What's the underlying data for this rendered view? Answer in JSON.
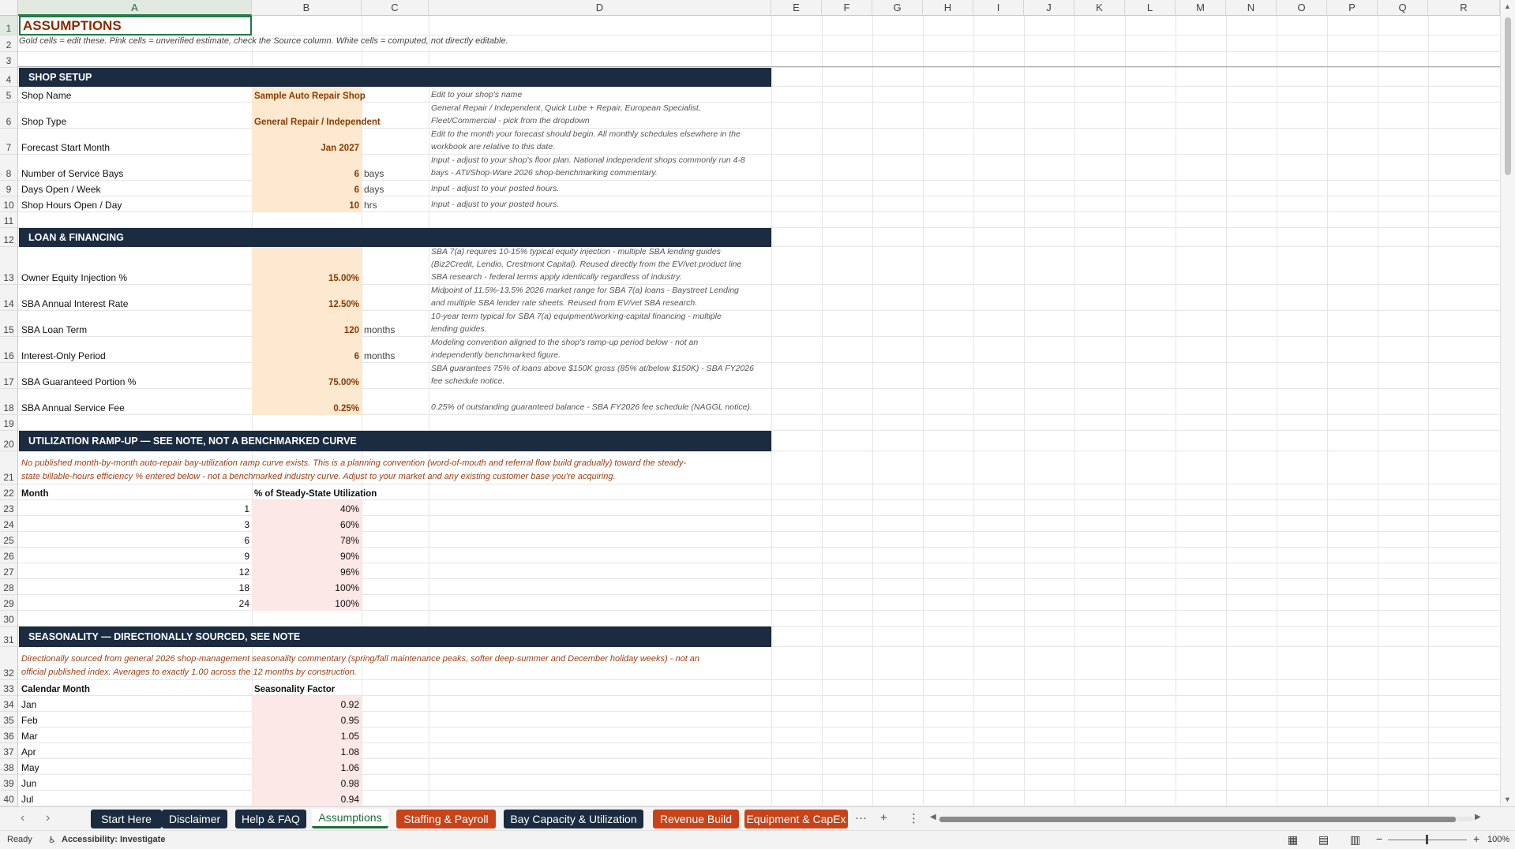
{
  "columns": [
    "A",
    "B",
    "C",
    "D",
    "E",
    "F",
    "G",
    "H",
    "I",
    "J",
    "K",
    "L",
    "M",
    "N",
    "O",
    "P",
    "Q",
    "R"
  ],
  "rows": [
    "1",
    "2",
    "3",
    "4",
    "5",
    "6",
    "7",
    "8",
    "9",
    "10",
    "11",
    "12",
    "13",
    "14",
    "15",
    "16",
    "17",
    "18",
    "19",
    "20",
    "21",
    "22",
    "23",
    "24",
    "25",
    "26",
    "27",
    "28",
    "29",
    "30",
    "31",
    "32",
    "33",
    "34",
    "35",
    "36",
    "37",
    "38",
    "39",
    "40"
  ],
  "title": "ASSUMPTIONS",
  "subtitle": "Gold cells = edit these. Pink cells = unverified estimate, check the Source column. White cells = computed, not directly editable.",
  "shop_setup": {
    "banner": "SHOP SETUP",
    "rows": [
      {
        "label": "Shop Name",
        "value": "Sample Auto Repair Shop",
        "unit": "",
        "note": [
          "Edit to your shop's name"
        ]
      },
      {
        "label": "Shop Type",
        "value": "General Repair / Independent",
        "unit": "",
        "note": [
          "General Repair / Independent, Quick Lube + Repair, European Specialist,",
          "Fleet/Commercial - pick from the dropdown"
        ]
      },
      {
        "label": "Forecast Start Month",
        "value": "Jan 2027",
        "unit": "",
        "note": [
          "Edit to the month your forecast should begin. All monthly schedules elsewhere in the",
          "workbook are relative to this date."
        ]
      },
      {
        "label": "Number of Service Bays",
        "value": "6",
        "unit": "bays",
        "note": [
          "Input - adjust to your shop's floor plan. National independent shops commonly run 4-8",
          "bays - ATI/Shop-Ware 2026 shop-benchmarking commentary."
        ]
      },
      {
        "label": "Days Open / Week",
        "value": "6",
        "unit": "days",
        "note": [
          "Input - adjust to your posted hours."
        ]
      },
      {
        "label": "Shop Hours Open / Day",
        "value": "10",
        "unit": "hrs",
        "note": [
          "Input - adjust to your posted hours."
        ]
      }
    ]
  },
  "loan": {
    "banner": "LOAN & FINANCING",
    "rows": [
      {
        "label": "Owner Equity Injection %",
        "value": "15.00%",
        "unit": "",
        "note": [
          "SBA 7(a) requires 10-15% typical equity injection - multiple SBA lending guides",
          "(Biz2Credit, Lendio, Crestmont Capital). Reused directly from the EV/vet product line",
          "SBA research - federal terms apply identically regardless of industry."
        ]
      },
      {
        "label": "SBA Annual Interest Rate",
        "value": "12.50%",
        "unit": "",
        "note": [
          "Midpoint of 11.5%-13.5% 2026 market range for SBA 7(a) loans - Baystreet Lending",
          "and multiple SBA lender rate sheets. Reused from EV/vet SBA research."
        ]
      },
      {
        "label": "SBA Loan Term",
        "value": "120",
        "unit": "months",
        "note": [
          "10-year term typical for SBA 7(a) equipment/working-capital financing - multiple",
          "lending guides."
        ]
      },
      {
        "label": "Interest-Only Period",
        "value": "6",
        "unit": "months",
        "note": [
          "Modeling convention aligned to the shop's ramp-up period below - not an",
          "independently benchmarked figure."
        ]
      },
      {
        "label": "SBA Guaranteed Portion %",
        "value": "75.00%",
        "unit": "",
        "note": [
          "SBA guarantees 75% of loans above $150K gross (85% at/below $150K) - SBA FY2026",
          "fee schedule notice."
        ]
      },
      {
        "label": "SBA Annual Service Fee",
        "value": "0.25%",
        "unit": "",
        "note": [
          "0.25% of outstanding guaranteed balance - SBA FY2026 fee schedule (NAGGL notice)."
        ]
      }
    ]
  },
  "ramp": {
    "banner": "UTILIZATION RAMP-UP  —  SEE NOTE, NOT A BENCHMARKED CURVE",
    "note": [
      "No published month-by-month auto-repair bay-utilization ramp curve exists. This is a planning convention (word-of-mouth and referral flow build gradually) toward the steady-",
      "state billable-hours efficiency % entered below - not a benchmarked industry curve. Adjust to your market and any existing customer base you're acquiring."
    ],
    "col_month": "Month",
    "col_pct": "% of Steady-State Utilization",
    "data": [
      {
        "month": "1",
        "pct": "40%"
      },
      {
        "month": "3",
        "pct": "60%"
      },
      {
        "month": "6",
        "pct": "78%"
      },
      {
        "month": "9",
        "pct": "90%"
      },
      {
        "month": "12",
        "pct": "96%"
      },
      {
        "month": "18",
        "pct": "100%"
      },
      {
        "month": "24",
        "pct": "100%"
      }
    ]
  },
  "season": {
    "banner": "SEASONALITY  —  DIRECTIONALLY SOURCED, SEE NOTE",
    "note": [
      "Directionally sourced from general 2026 shop-management seasonality commentary (spring/fall maintenance peaks, softer deep-summer and December holiday weeks) - not an",
      "official published index. Averages to exactly 1.00 across the 12 months by construction."
    ],
    "col_month": "Calendar Month",
    "col_factor": "Seasonality Factor",
    "data": [
      {
        "month": "Jan",
        "factor": "0.92"
      },
      {
        "month": "Feb",
        "factor": "0.95"
      },
      {
        "month": "Mar",
        "factor": "1.05"
      },
      {
        "month": "Apr",
        "factor": "1.08"
      },
      {
        "month": "May",
        "factor": "1.06"
      },
      {
        "month": "Jun",
        "factor": "0.98"
      },
      {
        "month": "Jul",
        "factor": "0.94"
      }
    ]
  },
  "tabs": [
    {
      "label": "Start Here",
      "style": "dark"
    },
    {
      "label": "Disclaimer",
      "style": "dark"
    },
    {
      "label": "Help & FAQ",
      "style": "dark"
    },
    {
      "label": "Assumptions",
      "style": "active"
    },
    {
      "label": "Staffing & Payroll",
      "style": "orange"
    },
    {
      "label": "Bay Capacity & Utilization",
      "style": "dark"
    },
    {
      "label": "Revenue Build",
      "style": "orange"
    },
    {
      "label": "Equipment & CapEx",
      "style": "orange"
    }
  ],
  "tabbar_icons": {
    "prev": "‹",
    "next": "›",
    "more": "···",
    "add": "+",
    "options": "⋮"
  },
  "status": {
    "ready": "Ready",
    "accessibility": "Accessibility: Investigate",
    "zoom": "100%",
    "zoom_minus": "−",
    "zoom_plus": "+"
  },
  "colors": {
    "banner": "#1b2b40",
    "gold": "#fde9d0",
    "pink": "#fce8e6",
    "input_text": "#8a3a00",
    "tab_orange": "#c8431a",
    "accent": "#1e6b3a"
  }
}
